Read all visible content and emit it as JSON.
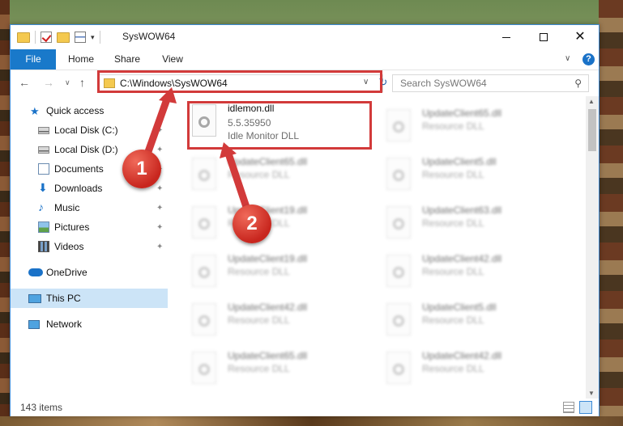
{
  "window": {
    "title": "SysWOW64"
  },
  "ribbon": {
    "tabs": [
      "File",
      "Home",
      "Share",
      "View"
    ],
    "help": "?"
  },
  "address": {
    "path": "C:\\Windows\\SysWOW64",
    "search_placeholder": "Search SysWOW64"
  },
  "sidebar": {
    "items": [
      {
        "label": "Quick access",
        "icon": "star-icon",
        "pinned": false
      },
      {
        "label": "Local Disk (C:)",
        "icon": "disk-icon",
        "pinned": true
      },
      {
        "label": "Local Disk (D:)",
        "icon": "disk-icon",
        "pinned": true
      },
      {
        "label": "Documents",
        "icon": "documents-icon",
        "pinned": true
      },
      {
        "label": "Downloads",
        "icon": "download-icon",
        "pinned": true
      },
      {
        "label": "Music",
        "icon": "music-icon",
        "pinned": true
      },
      {
        "label": "Pictures",
        "icon": "pictures-icon",
        "pinned": true
      },
      {
        "label": "Videos",
        "icon": "videos-icon",
        "pinned": true
      },
      {
        "label": "OneDrive",
        "icon": "onedrive-icon",
        "pinned": false
      },
      {
        "label": "This PC",
        "icon": "this-pc-icon",
        "pinned": false,
        "selected": true
      },
      {
        "label": "Network",
        "icon": "network-icon",
        "pinned": false
      }
    ]
  },
  "files": {
    "highlighted": {
      "name": "idlemon.dll",
      "version": "5.5.35950",
      "description": "Idle Monitor DLL"
    },
    "left_column": [
      {
        "name": "UpdateClient65.dll",
        "description": "Resource DLL"
      },
      {
        "name": "UpdateClient19.dll",
        "description": "Resource DLL"
      },
      {
        "name": "UpdateClient19.dll",
        "description": "Resource DLL"
      },
      {
        "name": "UpdateClient42.dll",
        "description": "Resource DLL"
      },
      {
        "name": "UpdateClient65.dll",
        "description": "Resource DLL"
      }
    ],
    "right_column": [
      {
        "name": "UpdateClient65.dll",
        "description": "Resource DLL"
      },
      {
        "name": "UpdateClient5.dll",
        "description": "Resource DLL"
      },
      {
        "name": "UpdateClient63.dll",
        "description": "Resource DLL"
      },
      {
        "name": "UpdateClient42.dll",
        "description": "Resource DLL"
      },
      {
        "name": "UpdateClient5.dll",
        "description": "Resource DLL"
      },
      {
        "name": "UpdateClient42.dll",
        "description": "Resource DLL"
      }
    ]
  },
  "status": {
    "item_count": "143 items"
  },
  "callouts": {
    "first": "1",
    "second": "2"
  },
  "colors": {
    "accent": "#1979ca",
    "highlight": "#d23a3a",
    "selected_bg": "#cce4f7"
  }
}
